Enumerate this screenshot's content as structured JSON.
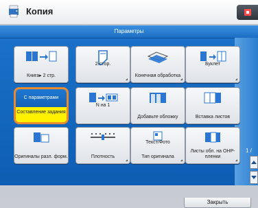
{
  "app": {
    "title": "Копия"
  },
  "panel": {
    "header": "Параметры"
  },
  "tiles": [
    {
      "label": "Книга▸ 2 стр.",
      "icon": "book-to-two-pages-icon"
    },
    {
      "label": "2-стор.",
      "icon": "two-sided-icon"
    },
    {
      "label": "Конечная обработка",
      "icon": "finishing-icon"
    },
    {
      "label": "Буклет",
      "icon": "booklet-icon"
    },
    {
      "label": "N на 1",
      "icon": "n-on-1-icon"
    },
    {
      "label": "Добавьте обложку",
      "icon": "add-cover-icon"
    },
    {
      "label": "Вставка листов",
      "icon": "insert-sheets-icon"
    },
    {
      "label": "Оригиналы разл. форм.",
      "icon": "different-size-originals-icon"
    },
    {
      "label": "Плотность",
      "icon": "density-icon"
    },
    {
      "label": "Тип оригинала",
      "icon": "original-type-icon"
    },
    {
      "label": "Листы обл. на OHP-пленки",
      "icon": "transparency-interleaf-icon"
    }
  ],
  "special": {
    "top_label": "С параметрами",
    "bottom_label": "Составление задания"
  },
  "tile_icon_text": {
    "original_type": "Текст/Фото"
  },
  "pagination": {
    "label": "1 /"
  },
  "close_button": {
    "label": "Закрыть"
  },
  "colors": {
    "panel_blue": "#1469c5",
    "highlight_orange": "#e88a2d",
    "highlight_yellow": "#fff100"
  }
}
